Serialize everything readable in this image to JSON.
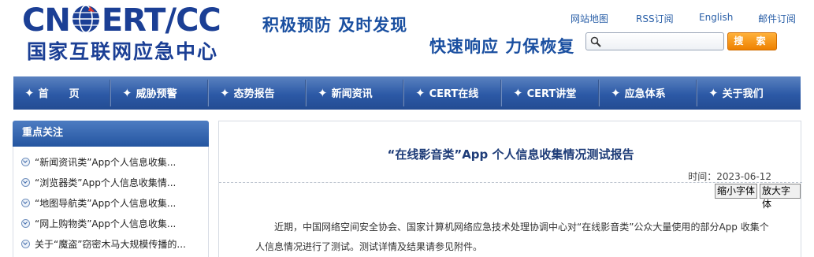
{
  "header": {
    "logo_en_left": "CN",
    "logo_en_right": "ERT/CC",
    "logo_cn": "国家互联网应急中心",
    "slogan_1": "积极预防 及时发现",
    "slogan_2": "快速响应 力保恢复",
    "top_links": [
      "网站地图",
      "RSS订阅",
      "English",
      "邮件订阅"
    ],
    "search_placeholder": "",
    "search_button": "搜 索"
  },
  "nav": {
    "items": [
      "首　　页",
      "威胁预警",
      "态势报告",
      "新闻资讯",
      "CERT在线",
      "CERT讲堂",
      "应急体系",
      "关于我们"
    ]
  },
  "sidebar": {
    "heading": "重点关注",
    "items": [
      "“新闻资讯类”App个人信息收集...",
      "“浏览器类”App个人信息收集情...",
      "“地图导航类”App个人信息收集...",
      "“网上购物类”App个人信息收集...",
      "关于“魔盗”窃密木马大规模传播的..."
    ]
  },
  "article": {
    "title": "“在线影音类”App 个人信息收集情况测试报告",
    "time": "时间：2023-06-12",
    "shrink_font": "缩小字体",
    "enlarge_font": "放大字体",
    "body": "近期，中国网络空间安全协会、国家计算机网络应急技术处理协调中心对“在线影音类”公众大量使用的部分App 收集个人信息情况进行了测试。测试详情及结果请参见附件。"
  },
  "colors": {
    "brand_blue": "#1b3f95",
    "nav_blue": "#2c59a6",
    "search_orange": "#ee8100"
  }
}
